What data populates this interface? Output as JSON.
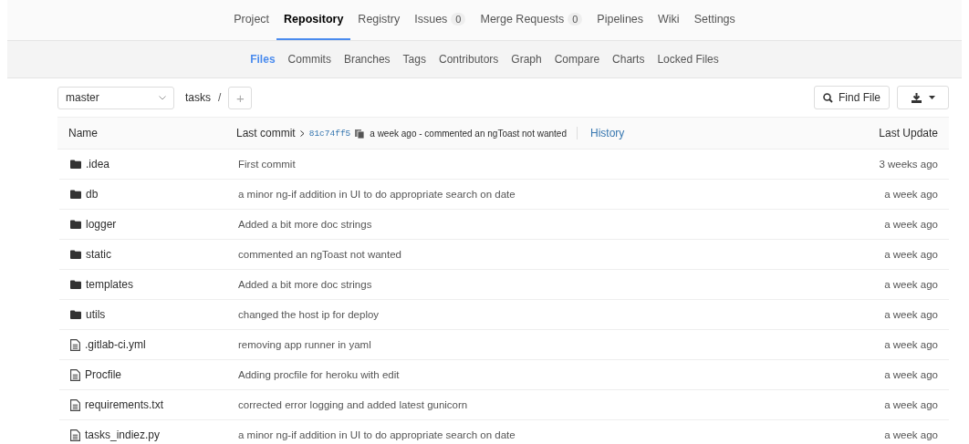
{
  "nav_tabs": [
    {
      "label": "Project",
      "selected": false
    },
    {
      "label": "Repository",
      "selected": true
    },
    {
      "label": "Registry",
      "selected": false
    },
    {
      "label": "Issues",
      "count": "0",
      "selected": false
    },
    {
      "label": "Merge Requests",
      "count": "0",
      "selected": false
    },
    {
      "label": "Pipelines",
      "selected": false
    },
    {
      "label": "Wiki",
      "selected": false
    },
    {
      "label": "Settings",
      "selected": false
    }
  ],
  "sub_tabs": [
    {
      "label": "Files",
      "selected": true
    },
    {
      "label": "Commits",
      "selected": false
    },
    {
      "label": "Branches",
      "selected": false
    },
    {
      "label": "Tags",
      "selected": false
    },
    {
      "label": "Contributors",
      "selected": false
    },
    {
      "label": "Graph",
      "selected": false
    },
    {
      "label": "Compare",
      "selected": false
    },
    {
      "label": "Charts",
      "selected": false
    },
    {
      "label": "Locked Files",
      "selected": false
    }
  ],
  "toolbar": {
    "branch": "master",
    "path": "tasks",
    "separator": "/",
    "add": "+",
    "find_file": "Find File"
  },
  "table": {
    "name_header": "Name",
    "last_commit_label": "Last commit",
    "commit_sha": "81c74ff5",
    "commit_info": "a week ago - commented an ngToast not wanted",
    "history": "History",
    "update_header": "Last Update",
    "rows": [
      {
        "kind": "folder",
        "name": ".idea",
        "message": "First commit",
        "updated": "3 weeks ago"
      },
      {
        "kind": "folder",
        "name": "db",
        "message": "a minor ng-if addition in UI to do appropriate search on date",
        "updated": "a week ago"
      },
      {
        "kind": "folder",
        "name": "logger",
        "message": "Added a bit more doc strings",
        "updated": "a week ago"
      },
      {
        "kind": "folder",
        "name": "static",
        "message": "commented an ngToast not wanted",
        "updated": "a week ago"
      },
      {
        "kind": "folder",
        "name": "templates",
        "message": "Added a bit more doc strings",
        "updated": "a week ago"
      },
      {
        "kind": "folder",
        "name": "utils",
        "message": "changed the host ip for deploy",
        "updated": "a week ago"
      },
      {
        "kind": "file",
        "name": ".gitlab-ci.yml",
        "message": "removing app runner in yaml",
        "updated": "a week ago"
      },
      {
        "kind": "file",
        "name": "Procfile",
        "message": "Adding procfile for heroku with edit",
        "updated": "a week ago"
      },
      {
        "kind": "file",
        "name": "requirements.txt",
        "message": "corrected error logging and added latest gunicorn",
        "updated": "a week ago"
      },
      {
        "kind": "file",
        "name": "tasks_indiez.py",
        "message": "a minor ng-if addition in UI to do appropriate search on date",
        "updated": "a week ago"
      }
    ]
  }
}
